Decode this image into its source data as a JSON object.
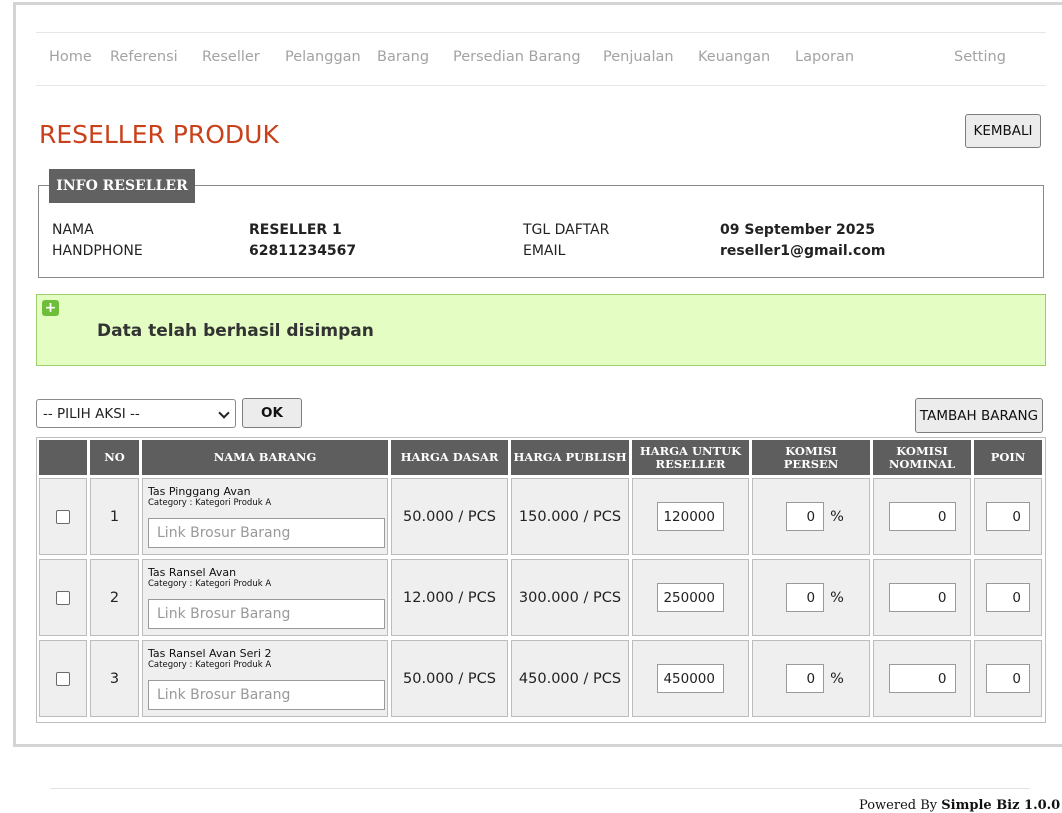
{
  "nav": {
    "items": [
      "Home",
      "Referensi",
      "Reseller",
      "Pelanggan",
      "Barang",
      "Persedian Barang",
      "Penjualan",
      "Keuangan",
      "Laporan"
    ],
    "setting": "Setting"
  },
  "page": {
    "title": "RESELLER PRODUK",
    "back_button": "KEMBALI"
  },
  "info": {
    "legend": "INFO RESELLER",
    "nama_label": "NAMA",
    "nama_value": "RESELLER 1",
    "handphone_label": "HANDPHONE",
    "handphone_value": "62811234567",
    "tgl_label": "TGL DAFTAR",
    "tgl_value": "09 September 2025",
    "email_label": "EMAIL",
    "email_value": "reseller1@gmail.com"
  },
  "alert": {
    "icon": "plus-icon",
    "symbol": "+",
    "message": "Data telah berhasil disimpan",
    "color": "#e3fdc2"
  },
  "actions": {
    "select_value": "-- PILIH AKSI --",
    "ok_button": "OK",
    "add_button": "TAMBAH BARANG"
  },
  "table": {
    "headers": {
      "no": "NO",
      "nama": "NAMA BARANG",
      "harga_dasar": "HARGA DASAR",
      "harga_publish": "HARGA PUBLISH",
      "harga_reseller_1": "HARGA UNTUK",
      "harga_reseller_2": "RESELLER",
      "komisi_persen_1": "KOMISI",
      "komisi_persen_2": "PERSEN",
      "komisi_nominal_1": "KOMISI",
      "komisi_nominal_2": "NOMINAL",
      "poin": "POIN"
    },
    "link_placeholder": "Link Brosur Barang",
    "percent_sign": "%",
    "rows": [
      {
        "no": "1",
        "name": "Tas Pinggang Avan",
        "category": "Category : Kategori Produk A",
        "harga_dasar": "50.000 / PCS",
        "harga_publish": "150.000 / PCS",
        "harga_reseller": "120000",
        "komisi_persen": "0",
        "komisi_nominal": "0",
        "poin": "0"
      },
      {
        "no": "2",
        "name": "Tas Ransel Avan",
        "category": "Category : Kategori Produk A",
        "harga_dasar": "12.000 / PCS",
        "harga_publish": "300.000 / PCS",
        "harga_reseller": "250000",
        "komisi_persen": "0",
        "komisi_nominal": "0",
        "poin": "0"
      },
      {
        "no": "3",
        "name": "Tas Ransel Avan Seri 2",
        "category": "Category : Kategori Produk A",
        "harga_dasar": "50.000 / PCS",
        "harga_publish": "450.000 / PCS",
        "harga_reseller": "450000",
        "komisi_persen": "0",
        "komisi_nominal": "0",
        "poin": "0"
      }
    ]
  },
  "footer": {
    "prefix": "Powered By",
    "brand": "Simple Biz 1.0.0"
  }
}
